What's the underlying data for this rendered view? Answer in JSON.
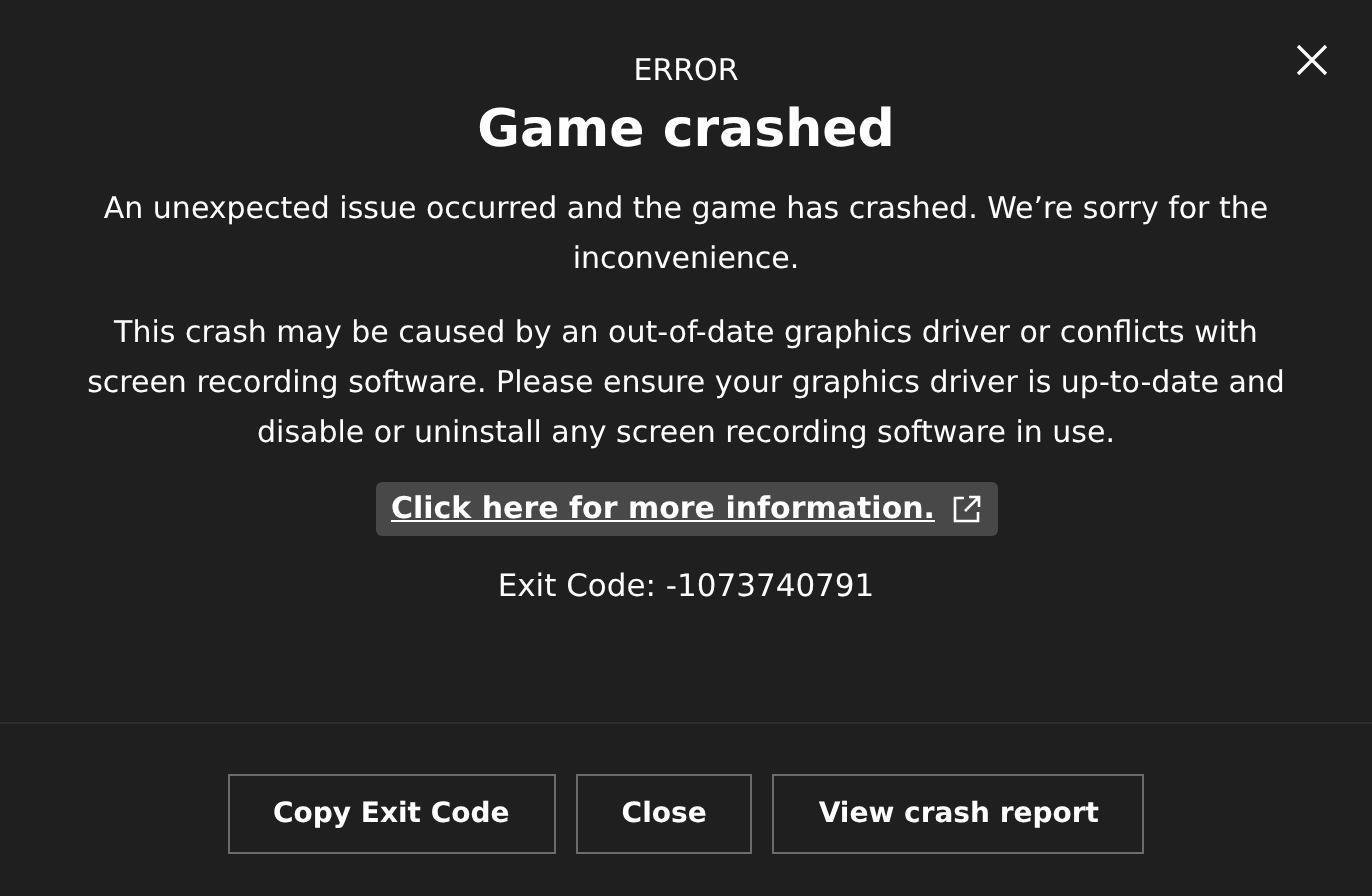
{
  "dialog": {
    "eyebrow": "ERROR",
    "title": "Game crashed",
    "paragraphs": [
      "An unexpected issue occurred and the game has crashed. We’re sorry for the inconvenience.",
      "This crash may be caused by an out-of-date graphics driver or conflicts with screen recording software. Please ensure your graphics driver is up-to-date and disable or uninstall any screen recording software in use."
    ],
    "link": "Click here for more information.",
    "exit_code": "Exit Code: -1073740791",
    "buttons": [
      "Copy Exit Code",
      "Close",
      "View crash report"
    ]
  }
}
